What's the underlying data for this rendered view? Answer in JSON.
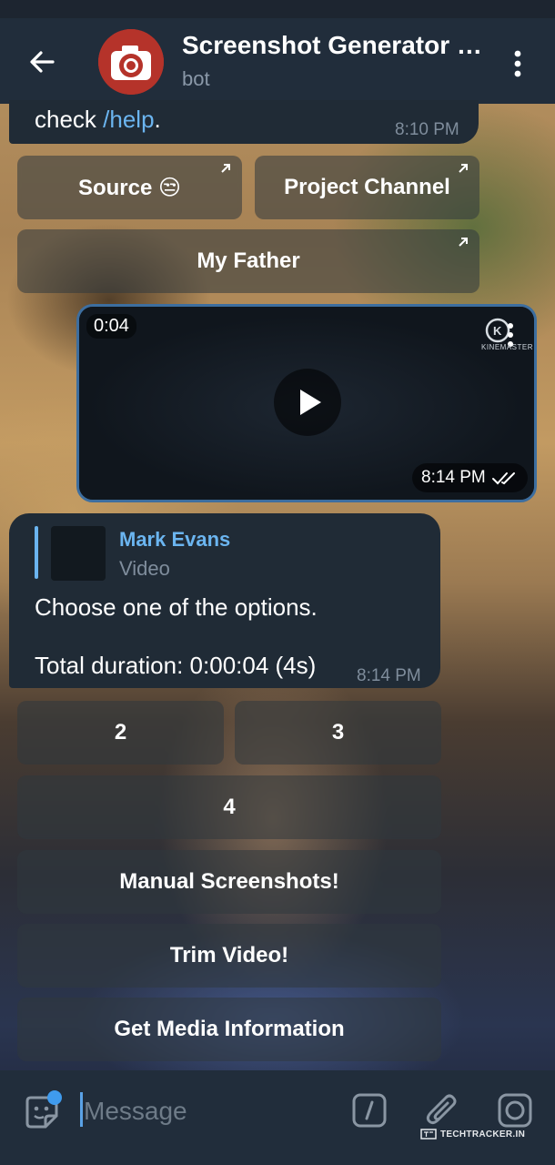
{
  "header": {
    "title": "Screenshot Generator Bot",
    "subtitle": "bot"
  },
  "messages": {
    "intro_prefix": "check ",
    "intro_link": "/help",
    "intro_suffix": ".",
    "intro_time": "8:10 PM",
    "video_duration": "0:04",
    "video_time": "8:14 PM",
    "kinemaster_label": "KINEMASTER",
    "reply_name": "Mark Evans",
    "reply_type": "Video",
    "main_line1": "Choose one of the options.",
    "main_line2": "Total duration: 0:00:04 (4s)",
    "main_time": "8:14 PM"
  },
  "keyboard_top": {
    "source": "Source 😒",
    "project_channel": "Project Channel",
    "my_father": "My Father"
  },
  "keyboard_options": {
    "opt2": "2",
    "opt3": "3",
    "opt4": "4",
    "manual": "Manual Screenshots!",
    "trim": "Trim Video!",
    "media_info": "Get Media Information"
  },
  "composer": {
    "placeholder": "Message"
  },
  "watermark": "TECHTRACKER.IN",
  "colors": {
    "header_bg": "#212d3b",
    "bubble_bg": "#202b36",
    "link": "#6bb5f0",
    "accent_border": "#3d6e9f"
  }
}
